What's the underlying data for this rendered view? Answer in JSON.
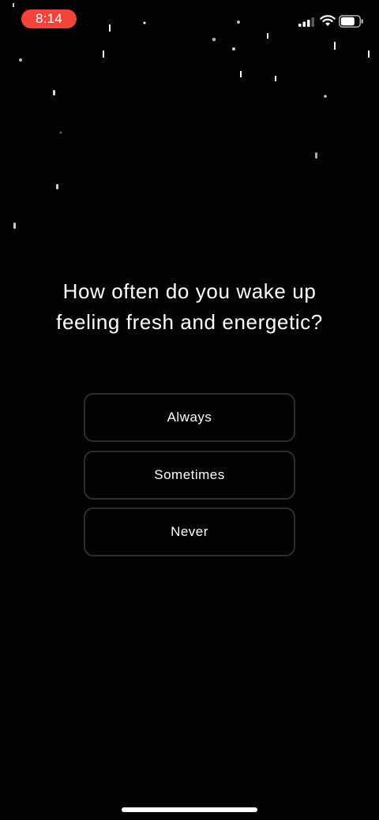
{
  "status_bar": {
    "time": "8:14",
    "time_pill_color": "#f2443a",
    "icons": [
      "cellular-signal-icon",
      "wifi-icon",
      "battery-icon"
    ]
  },
  "quiz": {
    "question": "How often do you wake up feeling fresh and energetic?",
    "options": [
      {
        "label": "Always"
      },
      {
        "label": "Sometimes"
      },
      {
        "label": "Never"
      }
    ]
  }
}
